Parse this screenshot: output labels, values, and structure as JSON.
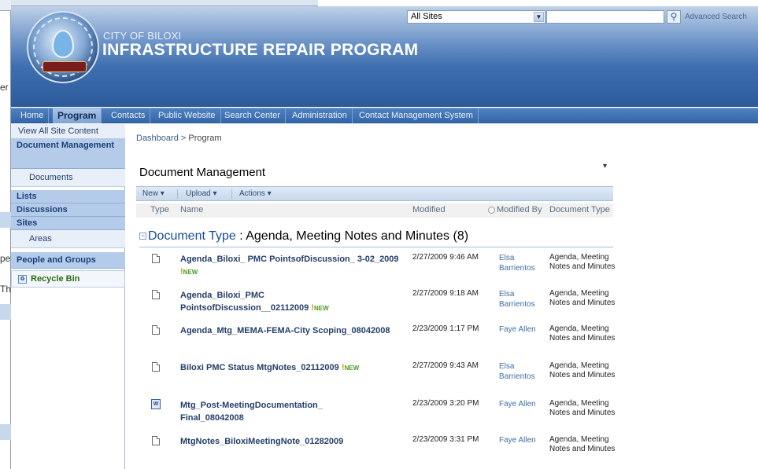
{
  "background_window": {
    "fragments": [
      "er",
      "pe",
      "Th"
    ]
  },
  "header": {
    "city": "CITY OF BILOXI",
    "title": "INFRASTRUCTURE REPAIR PROGRAM",
    "logo_text": "Infrastructure Repair Program",
    "site_selector": "All Sites",
    "search_placeholder": "",
    "advanced_search": "Advanced Search"
  },
  "nav": {
    "tabs": [
      {
        "label": "Home"
      },
      {
        "label": "Program"
      },
      {
        "label": "Contacts"
      },
      {
        "label": "Public Website"
      },
      {
        "label": "Search Center"
      },
      {
        "label": "Administration"
      },
      {
        "label": "Contact Management System"
      }
    ],
    "active": "Program"
  },
  "leftnav": {
    "view_all": "View All Site Content",
    "doc_mgmt": "Document Management",
    "documents": "Documents",
    "lists": "Lists",
    "discussions": "Discussions",
    "sites": "Sites",
    "areas": "Areas",
    "people": "People and Groups",
    "recycle": "Recycle Bin"
  },
  "breadcrumb": {
    "root": "Dashboard",
    "sep": " > ",
    "current": "Program"
  },
  "webpart": {
    "title": "Document Management",
    "menu": "▾",
    "toolbar": {
      "new": "New",
      "upload": "Upload",
      "actions": "Actions"
    },
    "columns": {
      "type": "Type",
      "name": "Name",
      "modified": "Modified",
      "modified_by": "Modified By",
      "doc_type": "Document Type"
    },
    "group": {
      "label": "Document Type",
      "separator": " : ",
      "value": "Agenda, Meeting Notes and Minutes",
      "count": "(8)"
    },
    "new_label": "NEW",
    "rows": [
      {
        "name": "Agenda_Biloxi_ PMC PointsofDiscussion_ 3-02_2009",
        "modified": "2/27/2009 9:46 AM",
        "by": "Elsa Barrientos",
        "type": "Agenda, Meeting Notes and Minutes"
      },
      {
        "name": "Agenda_Biloxi_PMC PointsofDiscussion__02112009",
        "modified": "2/27/2009 9:18 AM",
        "by": "Elsa Barrientos",
        "type": "Agenda, Meeting Notes and Minutes"
      },
      {
        "name": "Agenda_Mtg_MEMA-FEMA-City Scoping_08042008",
        "modified": "2/23/2009 1:17 PM",
        "by": "Faye Allen",
        "type": "Agenda, Meeting Notes and Minutes"
      },
      {
        "name": "Biloxi PMC Status MtgNotes_02112009",
        "modified": "2/27/2009 9:43 AM",
        "by": "Elsa Barrientos",
        "type": "Agenda, Meeting Notes and Minutes"
      },
      {
        "name": "Mtg_Post-MeetingDocumentation_ Final_08042008",
        "modified": "2/23/2009 3:20 PM",
        "by": "Faye Allen",
        "type": "Agenda, Meeting Notes and Minutes"
      },
      {
        "name": "MtgNotes_BiloxiMeetingNote_01282009",
        "modified": "2/23/2009 3:31 PM",
        "by": "Faye Allen",
        "type": "Agenda, Meeting Notes and Minutes"
      }
    ]
  }
}
